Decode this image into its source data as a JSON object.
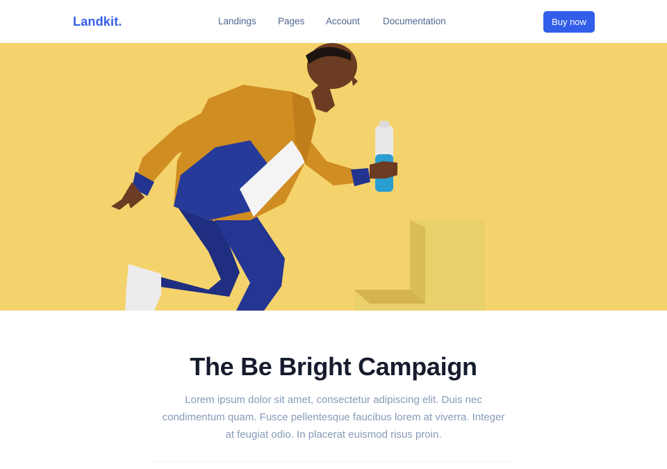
{
  "navbar": {
    "brand": "Landkit.",
    "links": [
      "Landings",
      "Pages",
      "Account",
      "Documentation"
    ],
    "cta": "Buy now",
    "accent_color": "#335eea"
  },
  "hero": {
    "background_color": "#f5d36c",
    "image_subject": "runner-holding-bottle-photo"
  },
  "section": {
    "title": "The Be Bright Campaign",
    "lead": "Lorem ipsum dolor sit amet, consectetur adipiscing elit. Duis nec condimentum quam. Fusce pellentesque faucibus lorem at viverra. Integer at feugiat odio. In placerat euismod risus proin."
  }
}
